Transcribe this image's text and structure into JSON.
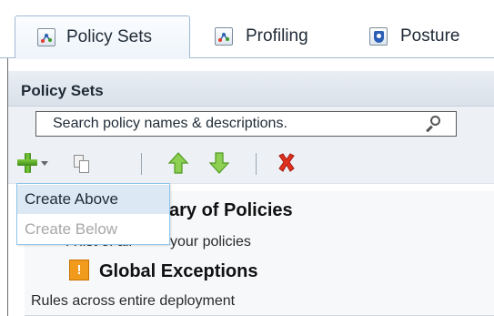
{
  "tabs": [
    {
      "label": "Policy Sets",
      "icon": "policy-sets-icon",
      "active": true
    },
    {
      "label": "Profiling",
      "icon": "profiling-icon",
      "active": false
    },
    {
      "label": "Posture",
      "icon": "posture-shield-icon",
      "active": false
    }
  ],
  "panel": {
    "title": "Policy Sets"
  },
  "search": {
    "placeholder": "Search policy names & descriptions.",
    "value": ""
  },
  "toolbar": {
    "add_icon": "plus-icon",
    "duplicate_icon": "duplicate-icon",
    "move_up_icon": "arrow-up-icon",
    "move_down_icon": "arrow-down-icon",
    "delete_icon": "delete-x-icon"
  },
  "menu": {
    "create_above": "Create Above",
    "create_below": "Create Below"
  },
  "items": [
    {
      "title_fragment": "ary of Policies",
      "desc_fragment": "your policies",
      "desc_prefix_fragment": "A list of all"
    },
    {
      "title": "Global Exceptions",
      "badge": "!",
      "desc": "Rules across entire deployment"
    }
  ],
  "colors": {
    "accent_blue": "#9fb9d3",
    "add_green": "#5aa82a",
    "delete_red": "#d9261c",
    "badge_orange": "#f19a1b",
    "menu_border": "#8ec5ea"
  }
}
